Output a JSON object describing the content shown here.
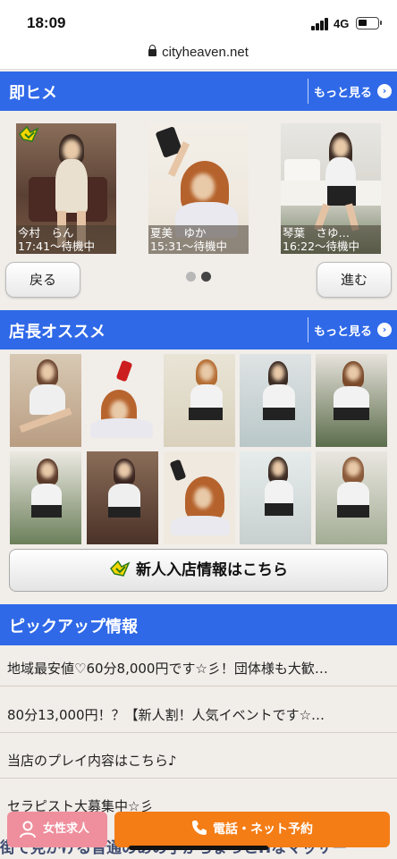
{
  "status": {
    "time": "18:09",
    "network": "4G"
  },
  "browser": {
    "url": "cityheaven.net"
  },
  "section1": {
    "title": "即ヒメ",
    "more_label": "もっと見る",
    "cards": [
      {
        "name": "今村　らん",
        "status": "17:41～待機中",
        "new": true
      },
      {
        "name": "夏美　ゆか",
        "status": "15:31～待機中",
        "new": false
      },
      {
        "name": "琴葉　さゆ…",
        "status": "16:22～待機中",
        "new": false
      }
    ],
    "back_label": "戻る",
    "next_label": "進む",
    "pager": {
      "count": 2,
      "active": 2
    }
  },
  "section2": {
    "title": "店長オススメ",
    "more_label": "もっと見る",
    "photo_count": 10,
    "newcomer_label": "新人入店情報はこちら"
  },
  "pickup": {
    "title": "ピックアップ情報",
    "items": [
      "地域最安値♡60分8,000円です☆彡！団体様も大歓…",
      "80分13,000円！？【新人割！人気イベントです☆…",
      "当店のプレイ内容はこちら♪",
      "セラピスト大募集中☆彡"
    ],
    "overflow_text": "街で見かける普通のあの子がちょっとHなマッサー"
  },
  "bottom": {
    "recruit_label": "女性求人",
    "call_label": "電話・ネット予約"
  },
  "colors": {
    "header_blue": "#2f69e8",
    "recruit_pink": "#ef8e9c",
    "call_orange": "#f47d16"
  }
}
